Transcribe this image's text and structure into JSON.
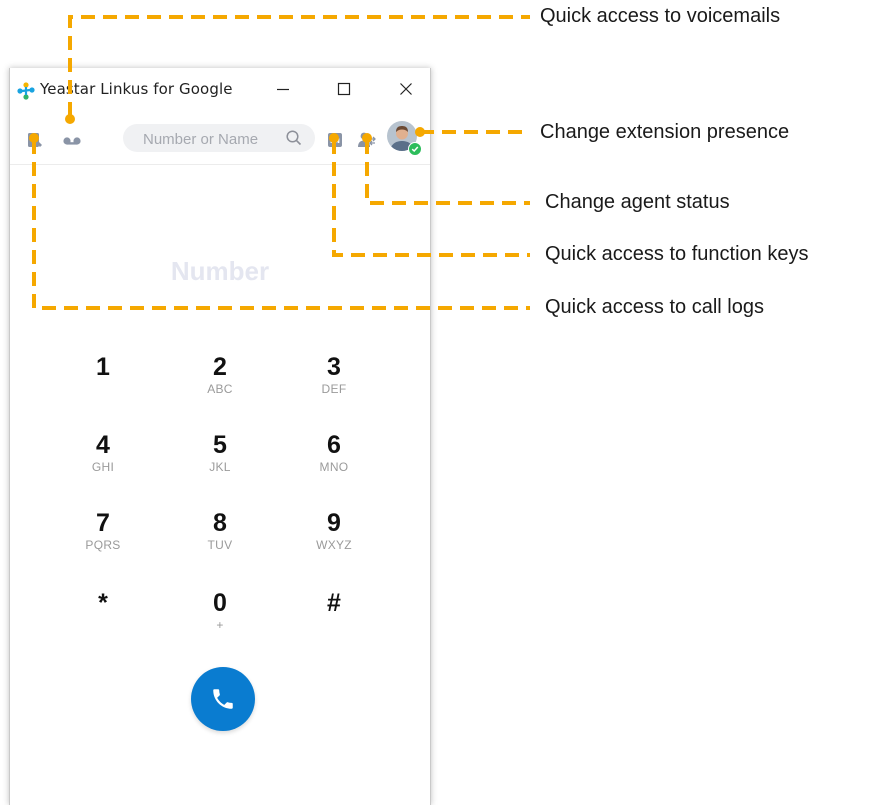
{
  "window": {
    "title": "Yeastar Linkus for Google",
    "controls": {
      "minimize": "minimize-icon",
      "maximize": "maximize-icon",
      "close": "close-icon"
    }
  },
  "toolbar": {
    "search_placeholder": "Number or Name",
    "icons": [
      "call-logs-icon",
      "voicemail-icon",
      "search-icon",
      "function-keys-icon",
      "agent-status-icon",
      "avatar"
    ],
    "presence_status_color": "#2dbd5c"
  },
  "dialer": {
    "number_placeholder": "Number",
    "keys": [
      {
        "digit": "1",
        "letters": ""
      },
      {
        "digit": "2",
        "letters": "ABC"
      },
      {
        "digit": "3",
        "letters": "DEF"
      },
      {
        "digit": "4",
        "letters": "GHI"
      },
      {
        "digit": "5",
        "letters": "JKL"
      },
      {
        "digit": "6",
        "letters": "MNO"
      },
      {
        "digit": "7",
        "letters": "PQRS"
      },
      {
        "digit": "8",
        "letters": "TUV"
      },
      {
        "digit": "9",
        "letters": "WXYZ"
      },
      {
        "digit": "*",
        "letters": ""
      },
      {
        "digit": "0",
        "letters": "+"
      },
      {
        "digit": "#",
        "letters": ""
      }
    ],
    "call_button_color": "#0a7cd0"
  },
  "annotations": {
    "voicemails": "Quick access to voicemails",
    "presence": "Change extension presence",
    "agent_status": "Change agent status",
    "function_keys": "Quick access to function keys",
    "call_logs": "Quick access to call logs",
    "line_color": "#f5a800"
  }
}
